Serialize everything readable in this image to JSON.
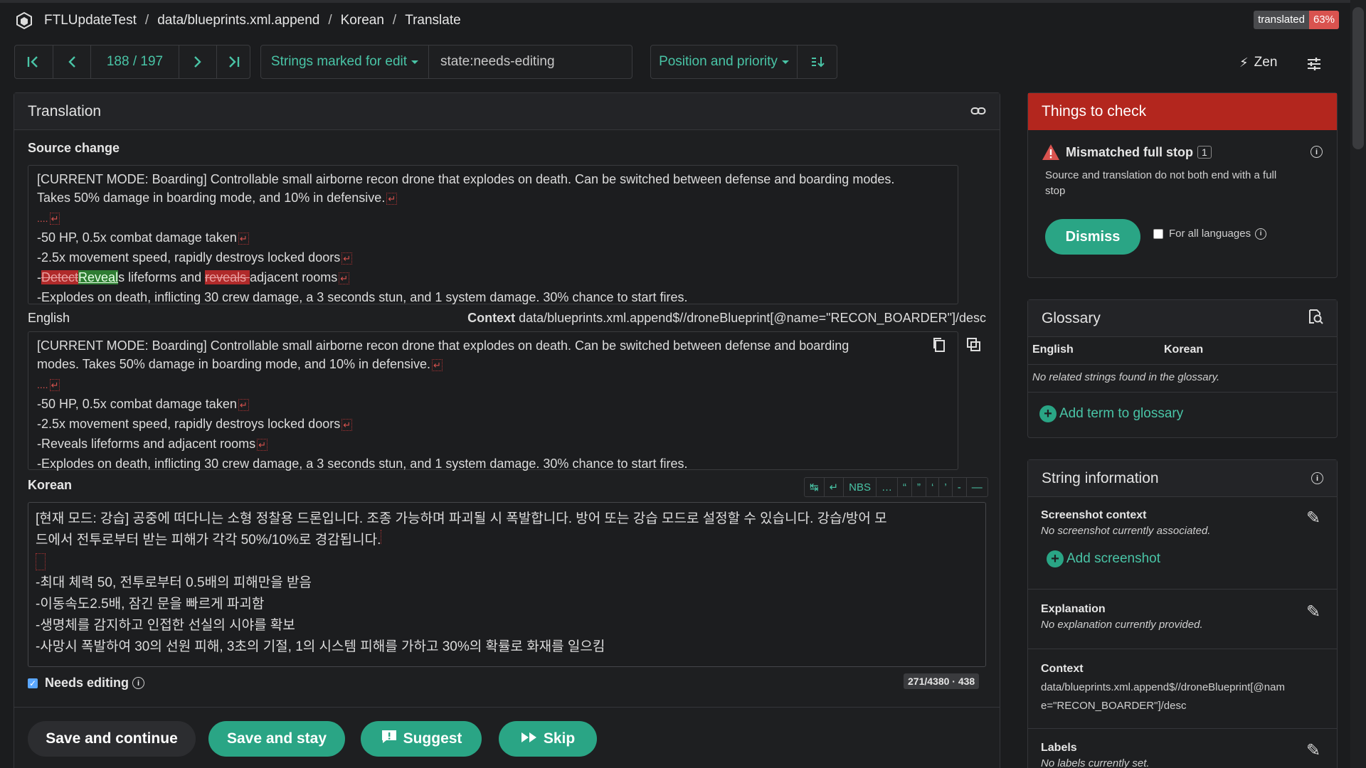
{
  "breadcrumb": {
    "project": "FTLUpdateTest",
    "component": "data/blueprints.xml.append",
    "language": "Korean",
    "page": "Translate"
  },
  "progress": {
    "label": "translated",
    "percent": "63%"
  },
  "nav": {
    "position": "188 / 197"
  },
  "filter": {
    "label": "Strings marked for edit",
    "query": "state:needs-editing"
  },
  "sort": {
    "label": "Position and priority"
  },
  "zen": {
    "label": "Zen"
  },
  "translation_panel": {
    "title": "Translation"
  },
  "source_change": {
    "label": "Source change",
    "line1": "[CURRENT MODE: Boarding] Controllable small airborne recon drone that explodes on death. Can be switched between defense and boarding modes.",
    "line2": "Takes 50% damage in boarding mode, and 10% in defensive.",
    "line3": "....",
    "line4": "-50 HP, 0.5x combat damage taken",
    "line5": "-2.5x movement speed, rapidly destroys locked doors",
    "line6_prefix": "-",
    "line6_del1": "Detect",
    "line6_ins1": "Reveal",
    "line6_mid": "s lifeforms and ",
    "line6_del2": "reveals ",
    "line6_end": "adjacent rooms",
    "line7": "-Explodes on death, inflicting 30 crew damage, a 3 seconds stun, and 1 system damage. 30% chance to start fires."
  },
  "english": {
    "label": "English",
    "context_label": "Context",
    "context_value": "data/blueprints.xml.append$//droneBlueprint[@name=\"RECON_BOARDER\"]/desc",
    "line1": "[CURRENT MODE: Boarding] Controllable small airborne recon drone that explodes on death. Can be switched between defense and boarding",
    "line2": "modes. Takes 50% damage in boarding mode, and 10% in defensive.",
    "line3": "....",
    "line4": "-50 HP, 0.5x combat damage taken",
    "line5": "-2.5x movement speed, rapidly destroys locked doors",
    "line6": "-Reveals lifeforms and adjacent rooms",
    "line7": "-Explodes on death, inflicting 30 crew damage, a 3 seconds stun, and 1 system damage. 30% chance to start fires."
  },
  "korean": {
    "label": "Korean",
    "line1": "[현재 모드: 강습] 공중에 떠다니는 소형 정찰용 드론입니다. 조종 가능하며 파괴될 시 폭발합니다. 방어 또는 강습 모드로 설정할 수 있습니다. 강습/방어 모",
    "line2": "드에서 전투로부터 받는 피해가 각각 50%/10%로 경감됩니다.",
    "line4": "-최대 체력 50, 전투로부터 0.5배의 피해만을 받음",
    "line5": "-이동속도2.5배, 잠긴 문을 빠르게 파괴함",
    "line6": "-생명체를 감지하고 인접한 선실의 시야를 확보",
    "line7": "-사망시 폭발하여 30의 선원 피해, 3초의 기절, 1의 시스템 피해를 가하고 30%의 확률로 화재를 일으킴"
  },
  "toolbar": {
    "nbs": "NBS",
    "ellipsis": "…",
    "q1": "“",
    "q2": "”",
    "q3": "‘",
    "q4": "’",
    "dash1": "-",
    "dash2": "—"
  },
  "needs_editing": {
    "label": "Needs editing",
    "checked": true
  },
  "counter": "271/4380 · 438",
  "buttons": {
    "save_continue": "Save and continue",
    "save_stay": "Save and stay",
    "suggest": "Suggest",
    "skip": "Skip"
  },
  "checks": {
    "title": "Things to check",
    "name": "Mismatched full stop",
    "count": "1",
    "description_l1": "Source and translation do not both end with a full",
    "description_l2": "stop",
    "dismiss": "Dismiss",
    "for_all": "For all languages"
  },
  "glossary": {
    "title": "Glossary",
    "col_source": "English",
    "col_target": "Korean",
    "empty": "No related strings found in the glossary.",
    "add": "Add term to glossary"
  },
  "string_info": {
    "title": "String information",
    "screenshot_label": "Screenshot context",
    "screenshot_empty": "No screenshot currently associated.",
    "add_screenshot": "Add screenshot",
    "explanation_label": "Explanation",
    "explanation_empty": "No explanation currently provided.",
    "context_label": "Context",
    "context_l1": "data/blueprints.xml.append$//droneBlueprint[@nam",
    "context_l2": "e=\"RECON_BOARDER\"]/desc",
    "labels_label": "Labels",
    "labels_empty": "No labels currently set."
  },
  "colors": {
    "accent": "#2aa585",
    "danger": "#b3261e",
    "background": "#1b1c1e"
  }
}
